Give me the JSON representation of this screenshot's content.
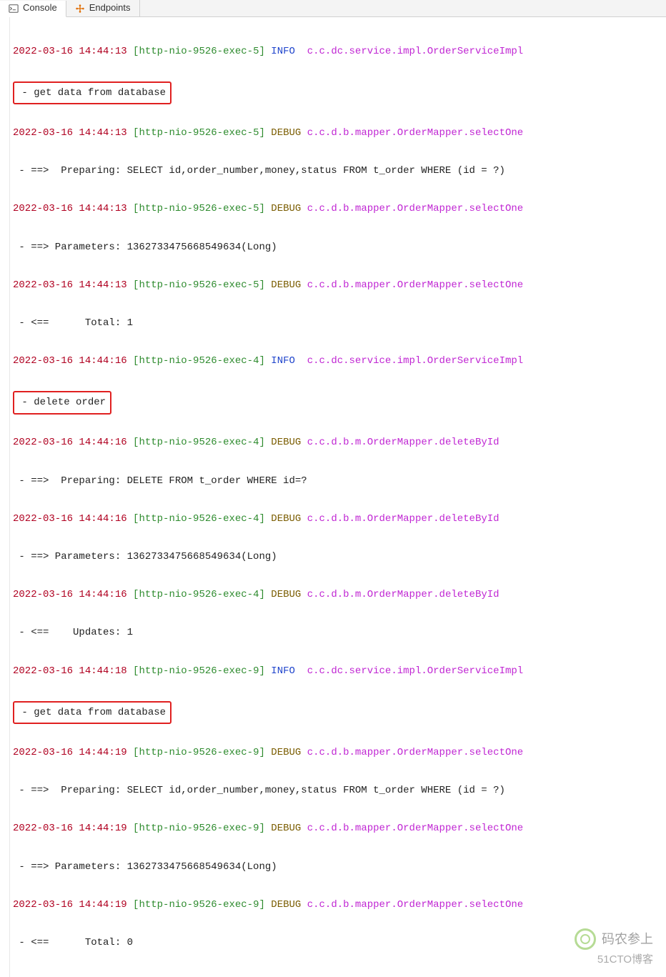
{
  "tabs": {
    "console": "Console",
    "endpoints": "Endpoints"
  },
  "box": {
    "b0": " - get data from database",
    "b1": " - delete order",
    "b2": " - get data from database"
  },
  "log": {
    "r0": {
      "ts": "2022-03-16 14:44:13",
      "thread": "[http-nio-9526-exec-5]",
      "level": "INFO ",
      "logger": "c.c.dc.service.impl.OrderServiceImpl"
    },
    "r1": {
      "ts": "2022-03-16 14:44:13",
      "thread": "[http-nio-9526-exec-5]",
      "level": "DEBUG",
      "logger": "c.c.d.b.mapper.OrderMapper.selectOne"
    },
    "r1c": " - ==>  Preparing: SELECT id,order_number,money,status FROM t_order WHERE (id = ?)",
    "r2": {
      "ts": "2022-03-16 14:44:13",
      "thread": "[http-nio-9526-exec-5]",
      "level": "DEBUG",
      "logger": "c.c.d.b.mapper.OrderMapper.selectOne"
    },
    "r2c": " - ==> Parameters: 1362733475668549634(Long)",
    "r3": {
      "ts": "2022-03-16 14:44:13",
      "thread": "[http-nio-9526-exec-5]",
      "level": "DEBUG",
      "logger": "c.c.d.b.mapper.OrderMapper.selectOne"
    },
    "r3c": " - <==      Total: 1",
    "r4": {
      "ts": "2022-03-16 14:44:16",
      "thread": "[http-nio-9526-exec-4]",
      "level": "INFO ",
      "logger": "c.c.dc.service.impl.OrderServiceImpl"
    },
    "r5": {
      "ts": "2022-03-16 14:44:16",
      "thread": "[http-nio-9526-exec-4]",
      "level": "DEBUG",
      "logger": "c.c.d.b.m.OrderMapper.deleteById"
    },
    "r5c": " - ==>  Preparing: DELETE FROM t_order WHERE id=?",
    "r6": {
      "ts": "2022-03-16 14:44:16",
      "thread": "[http-nio-9526-exec-4]",
      "level": "DEBUG",
      "logger": "c.c.d.b.m.OrderMapper.deleteById"
    },
    "r6c": " - ==> Parameters: 1362733475668549634(Long)",
    "r7": {
      "ts": "2022-03-16 14:44:16",
      "thread": "[http-nio-9526-exec-4]",
      "level": "DEBUG",
      "logger": "c.c.d.b.m.OrderMapper.deleteById"
    },
    "r7c": " - <==    Updates: 1",
    "r8": {
      "ts": "2022-03-16 14:44:18",
      "thread": "[http-nio-9526-exec-9]",
      "level": "INFO ",
      "logger": "c.c.dc.service.impl.OrderServiceImpl"
    },
    "r9": {
      "ts": "2022-03-16 14:44:19",
      "thread": "[http-nio-9526-exec-9]",
      "level": "DEBUG",
      "logger": "c.c.d.b.mapper.OrderMapper.selectOne"
    },
    "r9c": " - ==>  Preparing: SELECT id,order_number,money,status FROM t_order WHERE (id = ?)",
    "r10": {
      "ts": "2022-03-16 14:44:19",
      "thread": "[http-nio-9526-exec-9]",
      "level": "DEBUG",
      "logger": "c.c.d.b.mapper.OrderMapper.selectOne"
    },
    "r10c": " - ==> Parameters: 1362733475668549634(Long)",
    "r11": {
      "ts": "2022-03-16 14:44:19",
      "thread": "[http-nio-9526-exec-9]",
      "level": "DEBUG",
      "logger": "c.c.d.b.mapper.OrderMapper.selectOne"
    },
    "r11c": " - <==      Total: 0"
  },
  "watermark": {
    "name": "码农参上",
    "site": "51CTO博客"
  }
}
